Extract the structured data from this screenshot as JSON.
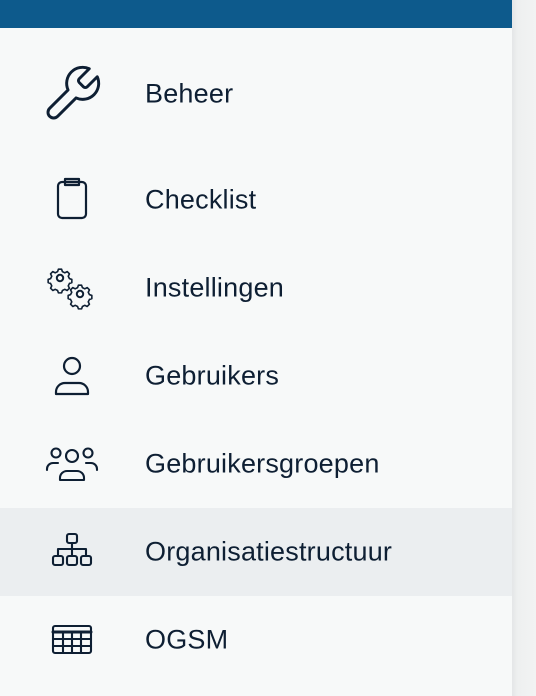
{
  "sidebar": {
    "items": [
      {
        "label": "Beheer",
        "icon": "wrench-icon"
      },
      {
        "label": "Checklist",
        "icon": "clipboard-icon"
      },
      {
        "label": "Instellingen",
        "icon": "gears-icon"
      },
      {
        "label": "Gebruikers",
        "icon": "user-icon"
      },
      {
        "label": "Gebruikersgroepen",
        "icon": "users-group-icon"
      },
      {
        "label": "Organisatiestructuur",
        "icon": "org-chart-icon",
        "active": true
      },
      {
        "label": "OGSM",
        "icon": "table-icon"
      }
    ]
  },
  "colors": {
    "topbar": "#0d5a8c",
    "text": "#0e1f33",
    "active_background": "#ebeef0",
    "background": "#f7f9f9"
  }
}
